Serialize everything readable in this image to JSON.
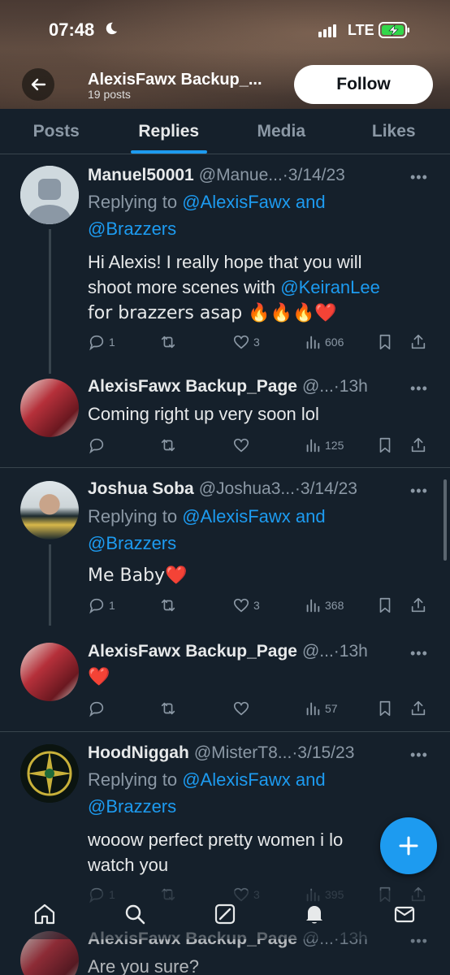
{
  "status_bar": {
    "time": "07:48",
    "network": "LTE"
  },
  "header": {
    "profile_name": "AlexisFawx Backup_...",
    "post_count": "19 posts",
    "follow_label": "Follow"
  },
  "tabs": [
    {
      "label": "Posts",
      "active": false
    },
    {
      "label": "Replies",
      "active": true
    },
    {
      "label": "Media",
      "active": false
    },
    {
      "label": "Likes",
      "active": false
    }
  ],
  "tweets": [
    {
      "name": "Manuel50001",
      "handle": "@Manue...",
      "date": "·3/14/23",
      "replying_prefix": "Replying to ",
      "replying_1": "@AlexisFawx and",
      "replying_2": "@Brazzers",
      "text_1": "Hi Alexis! I really hope that you will",
      "text_2a": "shoot more scenes with ",
      "text_2b": "@KeiranLee",
      "text_3": "for brazzers asap 🔥🔥🔥❤️",
      "replies": "1",
      "likes": "3",
      "views": "606"
    },
    {
      "name": "AlexisFawx Backup_Page",
      "handle": "@...",
      "date": "·13h",
      "text_1": "Coming right up very soon lol",
      "replies": "",
      "likes": "",
      "views": "125"
    },
    {
      "name": "Joshua Soba",
      "handle": "@Joshua3...",
      "date": "·3/14/23",
      "replying_prefix": "Replying to ",
      "replying_1": "@AlexisFawx and",
      "replying_2": "@Brazzers",
      "text_1": "Me Baby❤️",
      "replies": "1",
      "likes": "3",
      "views": "368"
    },
    {
      "name": "AlexisFawx Backup_Page",
      "handle": "@...",
      "date": "·13h",
      "text_1": "❤️",
      "replies": "",
      "likes": "",
      "views": "57"
    },
    {
      "name": "HoodNiggah",
      "handle": "@MisterT8...",
      "date": "·3/15/23",
      "replying_prefix": "Replying to ",
      "replying_1": "@AlexisFawx and",
      "replying_2": "@Brazzers",
      "text_1": "wooow perfect pretty women i lo",
      "text_2": "watch you",
      "replies": "1",
      "likes": "3",
      "views": "395"
    },
    {
      "name": "AlexisFawx Backup_Page",
      "handle": "@...",
      "date": "·13h",
      "text_1": "Are you sure?"
    }
  ],
  "icons": {
    "back": "arrow-left-icon",
    "compose": "plus-icon",
    "nav": [
      "home-icon",
      "search-icon",
      "grok-icon",
      "notifications-icon",
      "messages-icon"
    ]
  },
  "colors": {
    "accent": "#1d9bf0",
    "background": "#15202b",
    "muted": "#8b98a5"
  }
}
